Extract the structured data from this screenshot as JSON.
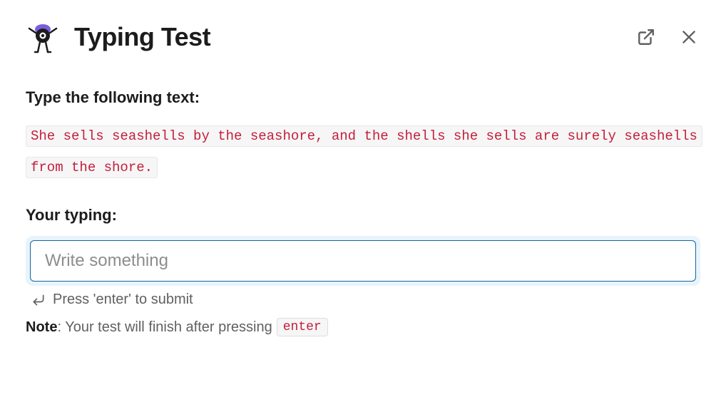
{
  "header": {
    "title": "Typing Test"
  },
  "prompt": {
    "label": "Type the following text:",
    "text": "She sells seashells by the seashore, and the shells she sells are surely seashells from the shore."
  },
  "input": {
    "label": "Your typing:",
    "placeholder": "Write something",
    "value": ""
  },
  "hint": {
    "text": "Press 'enter' to submit"
  },
  "note": {
    "label": "Note",
    "text": ": Your test will finish after pressing",
    "key": "enter"
  }
}
